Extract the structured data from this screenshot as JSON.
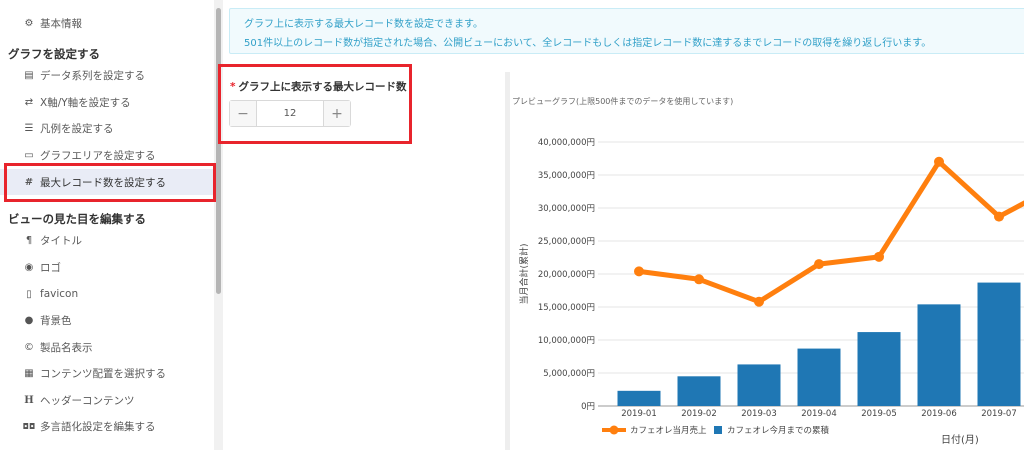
{
  "sidebar": {
    "basic_info": "基本情報",
    "section_graph": "グラフを設定する",
    "graph_items": [
      {
        "label": "データ系列を設定する",
        "icon": "database-icon"
      },
      {
        "label": "X軸/Y軸を設定する",
        "icon": "arrows-swap-icon"
      },
      {
        "label": "凡例を設定する",
        "icon": "list-icon"
      },
      {
        "label": "グラフエリアを設定する",
        "icon": "area-icon"
      },
      {
        "label": "最大レコード数を設定する",
        "icon": "hash-icon"
      }
    ],
    "section_view": "ビューの見た目を編集する",
    "view_items": [
      {
        "label": "タイトル",
        "icon": "paragraph-icon"
      },
      {
        "label": "ロゴ",
        "icon": "eye-icon"
      },
      {
        "label": "favicon",
        "icon": "bookmark-icon"
      },
      {
        "label": "背景色",
        "icon": "drop-icon"
      },
      {
        "label": "製品名表示",
        "icon": "copyright-icon"
      },
      {
        "label": "コンテンツ配置を選択する",
        "icon": "grid-icon"
      },
      {
        "label": "ヘッダーコンテンツ",
        "icon": "header-icon"
      },
      {
        "label": "多言語化設定を編集する",
        "icon": "language-icon"
      }
    ]
  },
  "info": {
    "line1": "グラフ上に表示する最大レコード数を設定できます。",
    "line2": "501件以上のレコード数が指定された場合、公開ビューにおいて、全レコードもしくは指定レコード数に達するまでレコードの取得を繰り返し行います。"
  },
  "field": {
    "required_mark": "*",
    "label": "グラフ上に表示する最大レコード数",
    "value": "12",
    "minus": "−",
    "plus": "+"
  },
  "preview": {
    "title": "プレビューグラフ(上限500件までのデータを使用しています)"
  },
  "colors": {
    "bar": "#1f77b4",
    "line": "#ff7f0e",
    "highlight": "#e8242c"
  },
  "chart_data": {
    "type": "bar",
    "categories": [
      "2019-01",
      "2019-02",
      "2019-03",
      "2019-04",
      "2019-05",
      "2019-06",
      "2019-07"
    ],
    "series": [
      {
        "name": "カフェオレ今月までの累積",
        "type": "bar",
        "values": [
          2300000,
          4500000,
          6300000,
          8700000,
          11200000,
          15400000,
          18700000
        ]
      },
      {
        "name": "カフェオレ当月売上",
        "type": "line",
        "values": [
          20400000,
          19200000,
          15800000,
          21500000,
          22600000,
          37000000,
          28700000
        ]
      }
    ],
    "line_continues_up": true,
    "ylabel": "当月合計(累計)",
    "xlabel": "日付(月)",
    "ylim": [
      0,
      40000000
    ],
    "yticks": [
      "0円",
      "5,000,000円",
      "10,000,000円",
      "15,000,000円",
      "20,000,000円",
      "25,000,000円",
      "30,000,000円",
      "35,000,000円",
      "40,000,000円"
    ],
    "grid": true,
    "legend": "bottom-left"
  }
}
